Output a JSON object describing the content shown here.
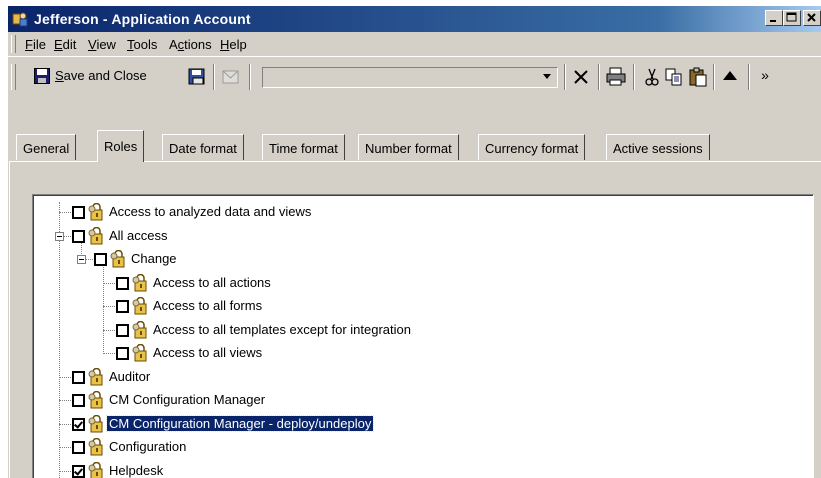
{
  "window": {
    "title": "Jefferson - Application Account",
    "controls": [
      "minimize",
      "maximize",
      "close"
    ]
  },
  "menu": {
    "items": [
      {
        "pre": "",
        "ul": "F",
        "post": "ile"
      },
      {
        "pre": "",
        "ul": "E",
        "post": "dit"
      },
      {
        "pre": "",
        "ul": "V",
        "post": "iew"
      },
      {
        "pre": "",
        "ul": "T",
        "post": "ools"
      },
      {
        "pre": "A",
        "ul": "c",
        "post": "tions"
      },
      {
        "pre": "",
        "ul": "H",
        "post": "elp"
      }
    ]
  },
  "toolbar": {
    "save_close": {
      "ul": "S",
      "post": "ave and Close"
    },
    "combo_value": "",
    "overflow": "»"
  },
  "tabs": [
    {
      "label": "General",
      "active": false
    },
    {
      "label": "Roles",
      "active": true
    },
    {
      "label": "Date format",
      "active": false
    },
    {
      "label": "Time format",
      "active": false
    },
    {
      "label": "Number format",
      "active": false
    },
    {
      "label": "Currency format",
      "active": false
    },
    {
      "label": "Active sessions",
      "active": false
    }
  ],
  "roles": [
    {
      "label": "Access to analyzed data and views",
      "checked": false,
      "level": 0,
      "expanded": null,
      "selected": false
    },
    {
      "label": "All access",
      "checked": false,
      "level": 0,
      "expanded": true,
      "selected": false
    },
    {
      "label": "Change",
      "checked": false,
      "level": 1,
      "expanded": true,
      "selected": false
    },
    {
      "label": "Access to all actions",
      "checked": false,
      "level": 2,
      "expanded": null,
      "selected": false
    },
    {
      "label": "Access to all forms",
      "checked": false,
      "level": 2,
      "expanded": null,
      "selected": false
    },
    {
      "label": "Access to all templates except for integration",
      "checked": false,
      "level": 2,
      "expanded": null,
      "selected": false
    },
    {
      "label": "Access to all views",
      "checked": false,
      "level": 2,
      "expanded": null,
      "selected": false
    },
    {
      "label": "Auditor",
      "checked": false,
      "level": 0,
      "expanded": null,
      "selected": false
    },
    {
      "label": "CM Configuration Manager",
      "checked": false,
      "level": 0,
      "expanded": null,
      "selected": false
    },
    {
      "label": "CM Configuration Manager - deploy/undeploy",
      "checked": true,
      "level": 0,
      "expanded": null,
      "selected": true
    },
    {
      "label": "Configuration",
      "checked": false,
      "level": 0,
      "expanded": null,
      "selected": false
    },
    {
      "label": "Helpdesk",
      "checked": true,
      "level": 0,
      "expanded": null,
      "selected": false
    }
  ],
  "colors": {
    "title_bar": "#0a246a",
    "selection": "#0a246a",
    "face": "#d4d0c8"
  }
}
